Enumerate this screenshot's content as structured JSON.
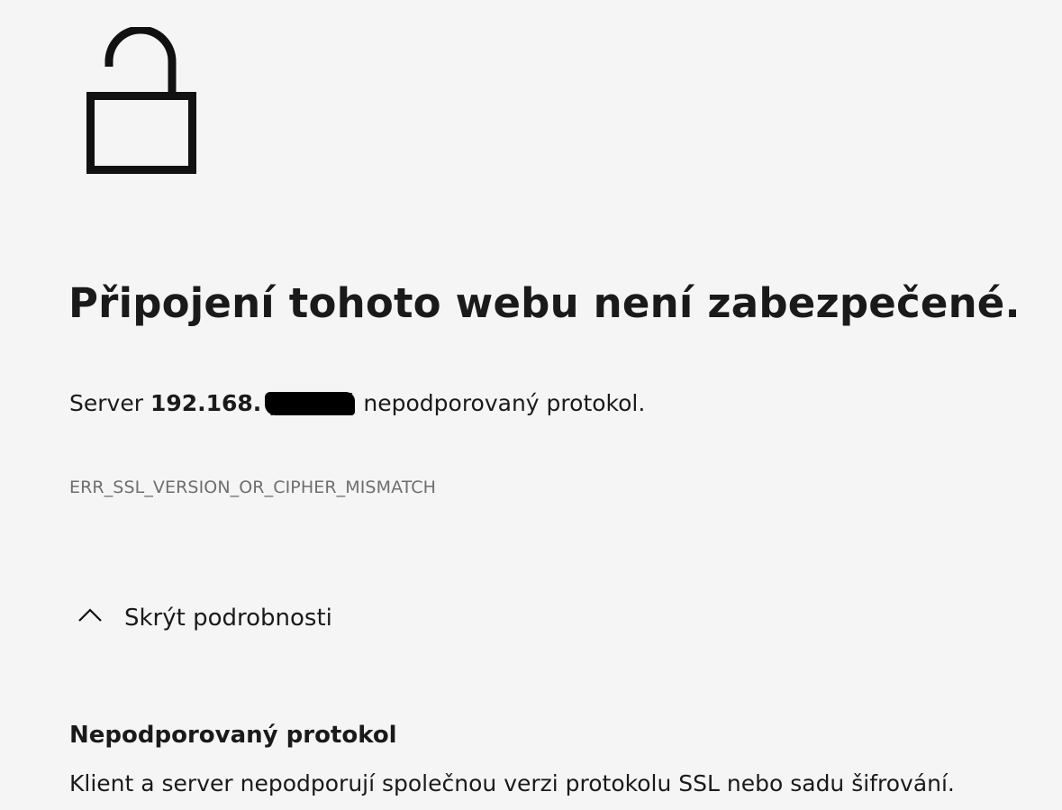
{
  "icon": "unlocked-padlock-icon",
  "title": "Připojení tohoto webu není zabezpečené.",
  "description": {
    "prefix": "Server ",
    "host": "192.168.",
    "suffix": " používá nepodporovaný protokol."
  },
  "error_code": "ERR_SSL_VERSION_OR_CIPHER_MISMATCH",
  "details_toggle": {
    "icon": "chevron-up-icon",
    "label": "Skrýt podrobnosti"
  },
  "details": {
    "heading": "Nepodporovaný protokol",
    "body": "Klient a server nepodporují společnou verzi protokolu SSL nebo sadu šifrování."
  }
}
